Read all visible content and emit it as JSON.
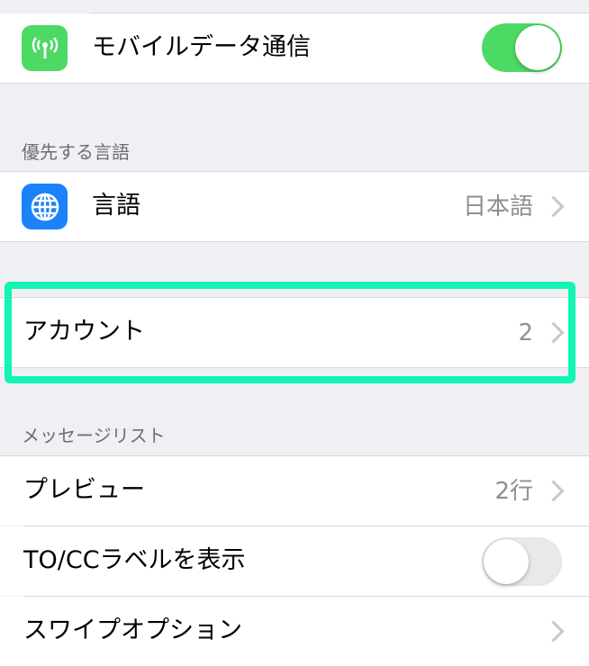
{
  "mobile_data": {
    "label": "モバイルデータ通信",
    "icon": "antenna-icon",
    "enabled": true,
    "accent": "#4cd964"
  },
  "preferred_language": {
    "header": "優先する言語",
    "language": {
      "label": "言語",
      "value": "日本語",
      "icon": "globe-icon",
      "icon_bg": "#1a82fb"
    }
  },
  "accounts": {
    "label": "アカウント",
    "value": "2"
  },
  "message_list": {
    "header": "メッセージリスト",
    "preview": {
      "label": "プレビュー",
      "value": "2行"
    },
    "to_cc_label": {
      "label": "TO/CCラベルを表示",
      "enabled": false
    },
    "swipe_options": {
      "label": "スワイプオプション"
    }
  },
  "highlight_color": "#12f5b4"
}
